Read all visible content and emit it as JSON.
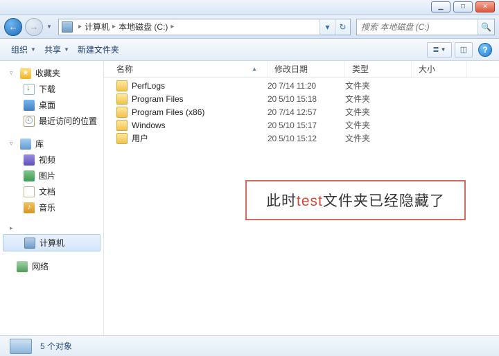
{
  "address": {
    "seg1": "计算机",
    "seg2": "本地磁盘 (C:)"
  },
  "search": {
    "placeholder": "搜索 本地磁盘 (C:)"
  },
  "toolbar": {
    "organize": "组织",
    "share": "共享",
    "newfolder": "新建文件夹"
  },
  "sidebar": {
    "favorites": "收藏夹",
    "downloads": "下载",
    "desktop": "桌面",
    "recent": "最近访问的位置",
    "libraries": "库",
    "videos": "视频",
    "pictures": "图片",
    "documents": "文档",
    "music": "音乐",
    "computer": "计算机",
    "network": "网络"
  },
  "columns": {
    "name": "名称",
    "date": "修改日期",
    "type": "类型",
    "size": "大小"
  },
  "files": [
    {
      "name": "PerfLogs",
      "date": "20  7/14 11:20",
      "type": "文件夹"
    },
    {
      "name": "Program Files",
      "date": "20  5/10 15:18",
      "type": "文件夹"
    },
    {
      "name": "Program Files (x86)",
      "date": "20  7/14 12:57",
      "type": "文件夹"
    },
    {
      "name": "Windows",
      "date": "20  5/10 15:17",
      "type": "文件夹"
    },
    {
      "name": "用户",
      "date": "20  5/10 15:12",
      "type": "文件夹"
    }
  ],
  "annotation": {
    "pre": "此时",
    "hl": "test",
    "post": "文件夹已经隐藏了"
  },
  "status": {
    "text": "5 个对象"
  }
}
